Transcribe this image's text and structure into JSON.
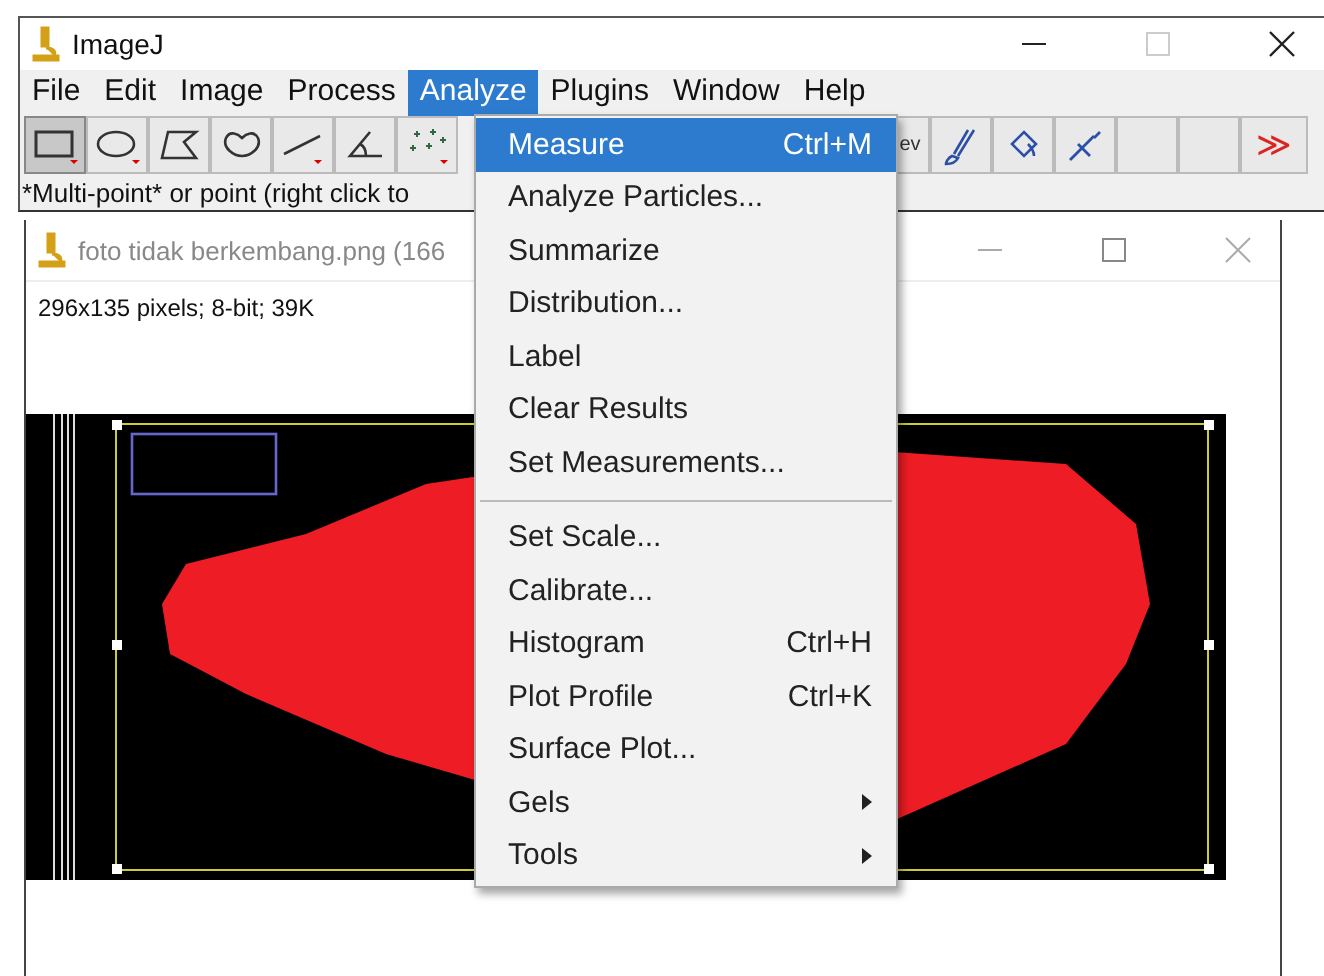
{
  "window": {
    "title": "ImageJ"
  },
  "menubar": [
    {
      "label": "File",
      "selected": false
    },
    {
      "label": "Edit",
      "selected": false
    },
    {
      "label": "Image",
      "selected": false
    },
    {
      "label": "Process",
      "selected": false
    },
    {
      "label": "Analyze",
      "selected": true
    },
    {
      "label": "Plugins",
      "selected": false
    },
    {
      "label": "Window",
      "selected": false
    },
    {
      "label": "Help",
      "selected": false
    }
  ],
  "toolbar": [
    {
      "kind": "rectangle",
      "selected": true
    },
    {
      "kind": "oval",
      "selected": false
    },
    {
      "kind": "polygon",
      "selected": false
    },
    {
      "kind": "freehand",
      "selected": false
    },
    {
      "kind": "line",
      "selected": false
    },
    {
      "kind": "angle",
      "selected": false
    },
    {
      "kind": "multipoint",
      "selected": false
    },
    {
      "kind": "gap"
    },
    {
      "kind": "text",
      "label": "ev",
      "selected": false
    },
    {
      "kind": "brush",
      "selected": false
    },
    {
      "kind": "bucket",
      "selected": false
    },
    {
      "kind": "pipette",
      "selected": false
    },
    {
      "kind": "empty",
      "selected": false
    },
    {
      "kind": "empty",
      "selected": false
    },
    {
      "kind": "more",
      "label": "≫",
      "selected": false
    }
  ],
  "status_bar": "*Multi-point* or point (right click to",
  "image_window": {
    "title": "foto tidak berkembang.png (166",
    "info": "296x135 pixels; 8-bit; 39K"
  },
  "menu": [
    {
      "kind": "item",
      "label": "Measure",
      "shortcut": "Ctrl+M",
      "selected": true
    },
    {
      "kind": "item",
      "label": "Analyze Particles...",
      "selected": false
    },
    {
      "kind": "item",
      "label": "Summarize",
      "selected": false
    },
    {
      "kind": "item",
      "label": "Distribution...",
      "selected": false
    },
    {
      "kind": "item",
      "label": "Label",
      "selected": false
    },
    {
      "kind": "item",
      "label": "Clear Results",
      "selected": false
    },
    {
      "kind": "item",
      "label": "Set Measurements...",
      "selected": false
    },
    {
      "kind": "separator"
    },
    {
      "kind": "item",
      "label": "Set Scale...",
      "selected": false
    },
    {
      "kind": "item",
      "label": "Calibrate...",
      "selected": false
    },
    {
      "kind": "item",
      "label": "Histogram",
      "shortcut": "Ctrl+H",
      "selected": false
    },
    {
      "kind": "item",
      "label": "Plot Profile",
      "shortcut": "Ctrl+K",
      "selected": false
    },
    {
      "kind": "item",
      "label": "Surface Plot...",
      "selected": false
    },
    {
      "kind": "submenu",
      "label": "Gels",
      "selected": false
    },
    {
      "kind": "submenu",
      "label": "Tools",
      "selected": false
    }
  ]
}
